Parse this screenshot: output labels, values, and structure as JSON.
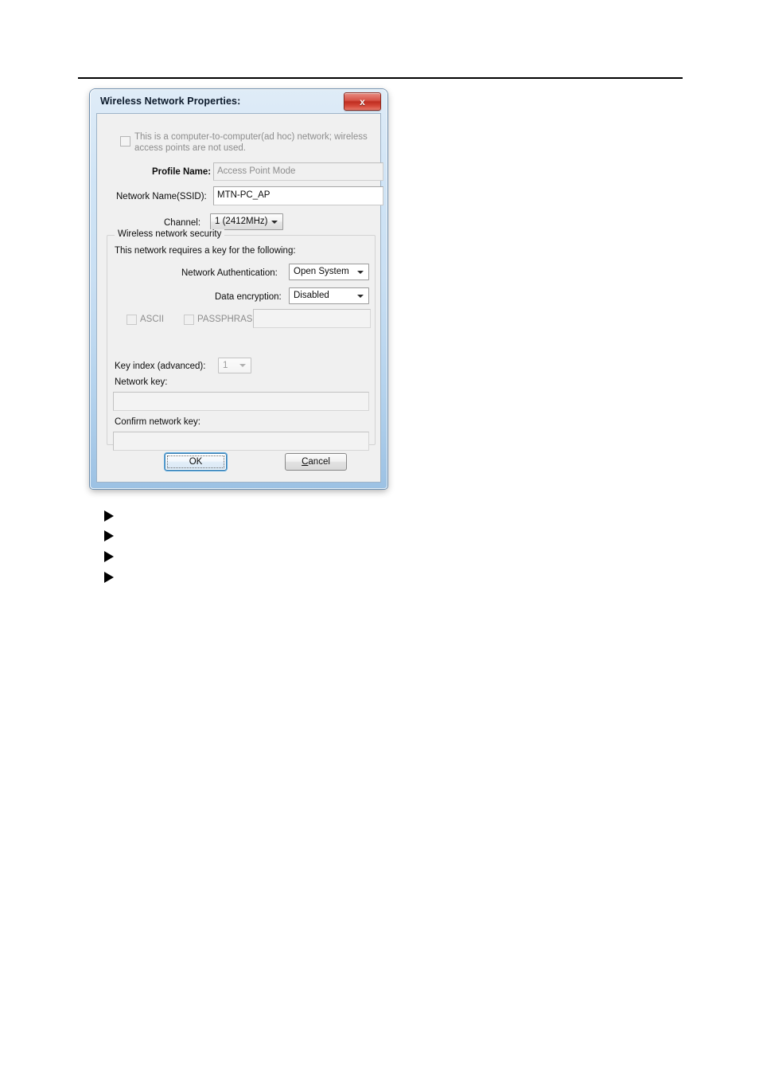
{
  "page": {
    "rule_present": true
  },
  "dialog": {
    "title": "Wireless Network Properties:",
    "close_button": {
      "label": "x",
      "icon": "close-icon",
      "color": "#c02d20"
    },
    "adhoc_checkbox": {
      "label": "This is a computer-to-computer(ad hoc) network; wireless access points are not used.",
      "checked": false,
      "enabled": false
    },
    "profile_name": {
      "label": "Profile Name:",
      "value": "Access Point Mode",
      "enabled": false
    },
    "network_name": {
      "label": "Network Name(SSID):",
      "value": "MTN-PC_AP",
      "enabled": true
    },
    "channel": {
      "label": "Channel:",
      "value": "1  (2412MHz)",
      "enabled": true
    },
    "security_group": {
      "title": "Wireless network security",
      "description": "This network requires a key for the following:",
      "network_authentication": {
        "label": "Network Authentication:",
        "value": "Open System"
      },
      "data_encryption": {
        "label": "Data encryption:",
        "value": "Disabled"
      },
      "ascii_checkbox": {
        "label": "ASCII",
        "checked": false,
        "enabled": false
      },
      "passphrase_checkbox": {
        "label": "PASSPHRASE",
        "checked": false,
        "enabled": false
      },
      "passphrase_input": {
        "value": "",
        "enabled": false
      },
      "key_index": {
        "label": "Key index (advanced):",
        "value": "1",
        "enabled": false
      },
      "network_key": {
        "label": "Network key:",
        "value": "",
        "enabled": false
      },
      "confirm_network_key": {
        "label": "Confirm network key:",
        "value": "",
        "enabled": false
      }
    },
    "buttons": {
      "ok": "OK",
      "cancel_prefix": "",
      "cancel_accel": "C",
      "cancel_suffix": "ancel"
    }
  },
  "bullets": {
    "count": 4,
    "glyph": "triangle-right"
  }
}
